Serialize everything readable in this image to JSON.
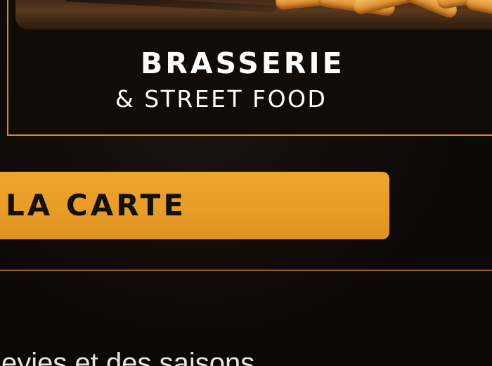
{
  "hero": {
    "title": "BRASSERIE",
    "subtitle": "& STREET FOOD",
    "photo_icon": "fries-on-board-image"
  },
  "menu_button": {
    "label": "LA CARTE"
  },
  "intro": {
    "text": "eyies et des saisons"
  },
  "colors": {
    "accent": "#e89e27",
    "border": "#d08a22",
    "background": "#0d0907",
    "text": "#ffffff"
  }
}
